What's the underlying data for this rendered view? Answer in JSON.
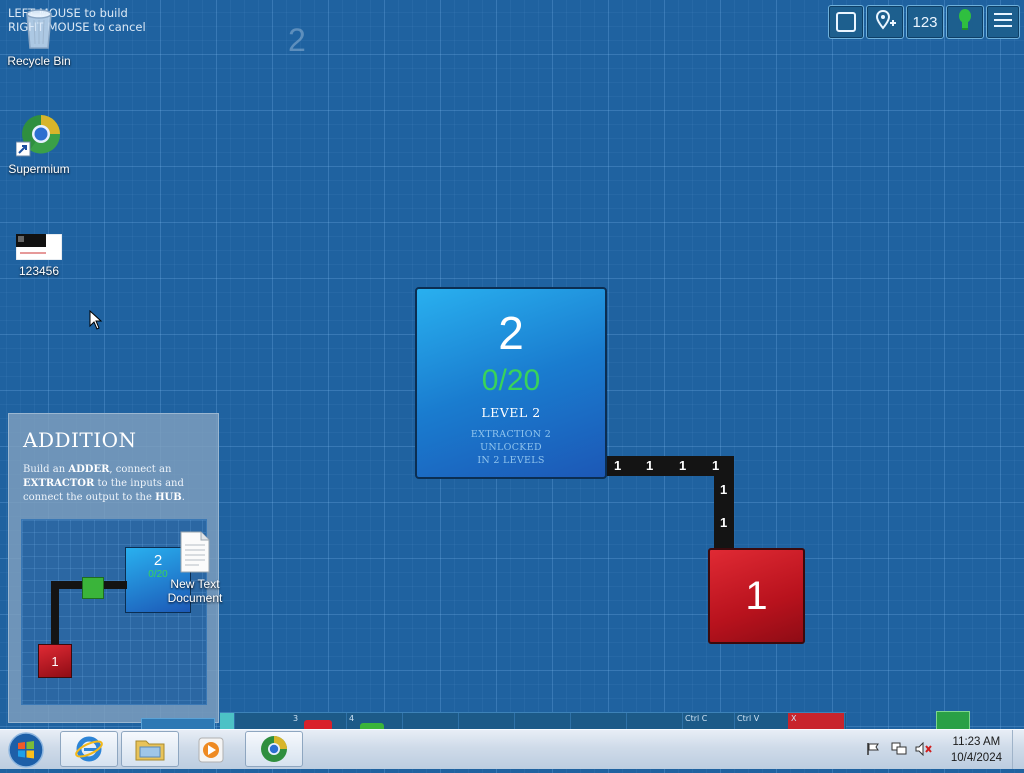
{
  "game": {
    "hint_line1": "LEFT MOUSE to build",
    "hint_line2": "RIGHT MOUSE to cancel",
    "level_ghost": "2",
    "toolbar": {
      "square_label": "",
      "marker_label": "",
      "numbers_label": "123",
      "bulb_label": "",
      "menu_label": ""
    },
    "level_block": {
      "number": "2",
      "progress": "0/20",
      "progress_fraction": 0.0,
      "name": "LEVEL 2",
      "note_line1": "EXTRACTION 2",
      "note_line2": "UNLOCKED",
      "note_line3": "IN 2 LEVELS"
    },
    "belt_values": [
      "1",
      "1",
      "1",
      "1",
      "1",
      "1"
    ],
    "extractor": {
      "value": "1"
    },
    "tutorial": {
      "title": "ADDITION",
      "text_1": "Build an ",
      "adder": "ADDER",
      "text_2": ", connect an ",
      "extractor": "EXTRACTOR",
      "text_3": " to the inputs and connect the output to the ",
      "hub": "HUB",
      "text_4": ".",
      "preview_hub_number": "2",
      "preview_hub_progress": "0/20",
      "preview_extractor": "1"
    },
    "strip": {
      "cell_1": "3",
      "cell_2": "4",
      "cell_3": "Ctrl C",
      "cell_4": "Ctrl V",
      "cell_5": "X"
    }
  },
  "desktop": {
    "icons": [
      {
        "label": "Recycle Bin",
        "icon": "recycle-bin-icon"
      },
      {
        "label": "Supermium",
        "icon": "supermium-browser-icon"
      },
      {
        "label": "123456",
        "icon": "image-file-icon"
      },
      {
        "label_line1": "New Text",
        "label_line2": "Document",
        "icon": "text-document-icon"
      }
    ]
  },
  "taskbar": {
    "time": "11:23 AM",
    "date": "10/4/2024",
    "apps": [
      "start-orb",
      "internet-explorer",
      "file-explorer",
      "media-player",
      "supermium"
    ]
  },
  "colors": {
    "background": "#1f62a0",
    "hub_blue": "#1a7ccf",
    "progress_green": "#39d35a",
    "extractor_red": "#b8121d"
  }
}
